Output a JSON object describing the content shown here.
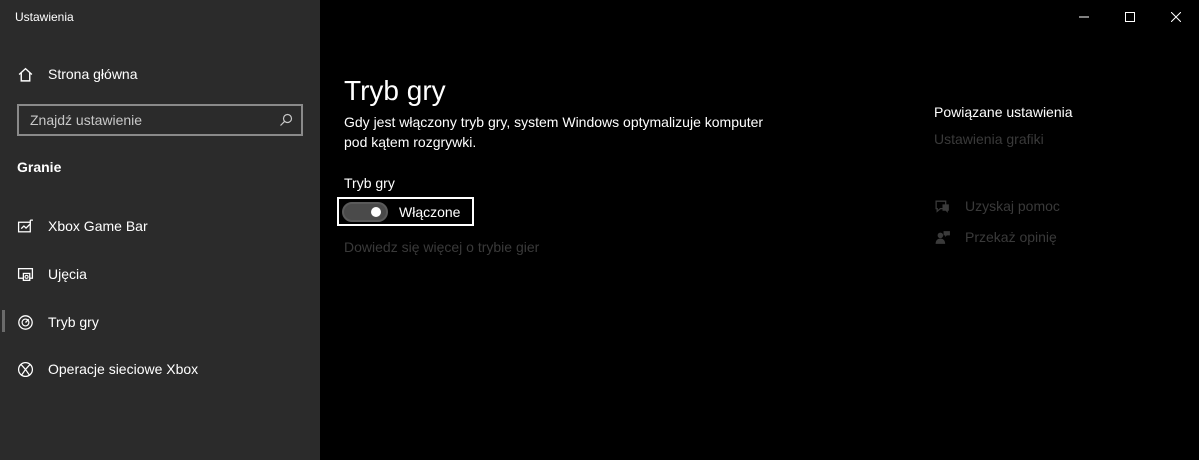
{
  "window": {
    "title": "Ustawienia"
  },
  "sidebar": {
    "home_label": "Strona główna",
    "search_placeholder": "Znajdź ustawienie",
    "section_title": "Granie",
    "items": [
      {
        "label": "Xbox Game Bar",
        "icon": "xbox-game-bar-icon"
      },
      {
        "label": "Ujęcia",
        "icon": "captures-icon"
      },
      {
        "label": "Tryb gry",
        "icon": "game-mode-icon",
        "selected": true
      },
      {
        "label": "Operacje sieciowe Xbox",
        "icon": "xbox-icon"
      }
    ]
  },
  "main": {
    "title": "Tryb gry",
    "description": "Gdy jest włączony tryb gry, system Windows optymalizuje komputer pod kątem rozgrywki.",
    "toggle": {
      "label": "Tryb gry",
      "state_text": "Włączone",
      "on": true
    },
    "learn_more": "Dowiedz się więcej o trybie gier"
  },
  "related": {
    "title": "Powiązane ustawienia",
    "link": "Ustawienia grafiki",
    "help": [
      {
        "label": "Uzyskaj pomoc",
        "icon": "help-icon"
      },
      {
        "label": "Przekaż opinię",
        "icon": "feedback-icon"
      }
    ]
  },
  "colors": {
    "sidebar_bg": "#2b2b2b",
    "main_bg": "#000000",
    "disabled_text": "#3a3a3a"
  }
}
